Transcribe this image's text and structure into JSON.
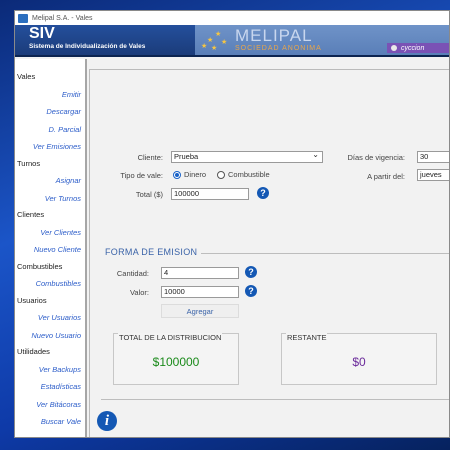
{
  "window": {
    "title": "Melipal S.A. - Vales"
  },
  "header": {
    "app_name": "SIV",
    "app_subtitle": "Sistema de Individualización de Vales",
    "logo_text": "MELIPAL",
    "logo_subtext": "SOCIEDAD ANONIMA",
    "user": "cyccion"
  },
  "sidebar": {
    "vales": {
      "title": "Vales",
      "items": [
        "Emitir",
        "Descargar",
        "D. Parcial",
        "Ver Emisiones"
      ]
    },
    "turnos": {
      "title": "Turnos",
      "items": [
        "Asignar",
        "Ver Turnos"
      ]
    },
    "clientes": {
      "title": "Clientes",
      "items": [
        "Ver Clientes",
        "Nuevo Cliente"
      ]
    },
    "combustibles": {
      "title": "Combustibles",
      "items": [
        "Combustibles"
      ]
    },
    "usuarios": {
      "title": "Usuarios",
      "items": [
        "Ver Usuarios",
        "Nuevo Usuario"
      ]
    },
    "utilidades": {
      "title": "Utilidades",
      "items": [
        "Ver Backups",
        "Estadísticas",
        "Ver Bitácoras",
        "Buscar Vale"
      ]
    }
  },
  "form": {
    "cliente_label": "Cliente:",
    "cliente_value": "Prueba",
    "tipo_label": "Tipo de vale:",
    "tipo_options": [
      "Dinero",
      "Combustible"
    ],
    "tipo_selected": "Dinero",
    "total_label": "Total ($)",
    "total_value": "100000",
    "dias_label": "Días de vigencia:",
    "dias_value": "30",
    "partir_label": "A partir del:",
    "partir_value": "jueves"
  },
  "emision": {
    "section_title": "FORMA DE EMISION",
    "cantidad_label": "Cantidad:",
    "cantidad_value": "4",
    "valor_label": "Valor:",
    "valor_value": "10000",
    "agregar_label": "Agregar",
    "total_dist_title": "TOTAL DE LA DISTRIBUCION",
    "total_dist_value": "$100000",
    "restante_title": "RESTANTE",
    "restante_value": "$0"
  },
  "colors": {
    "accent": "#1458b4",
    "total_green": "#1a8a1a",
    "restante_purple": "#6a2a9a",
    "user_tab": "#7a52b5"
  },
  "icons": {
    "help": "question-circle-icon",
    "info": "info-circle-icon"
  }
}
